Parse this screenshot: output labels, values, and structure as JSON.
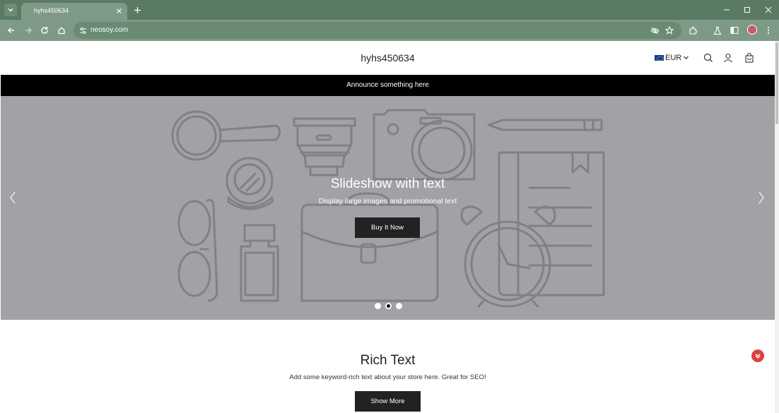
{
  "browser": {
    "tab_title": "hyhs450634",
    "url": "neosoy.com",
    "icons": {
      "tab_menu": "chevron-down-icon",
      "tab_close": "close-icon",
      "new_tab": "plus-icon",
      "minimize": "minimize-icon",
      "maximize": "maximize-icon",
      "close_window": "close-icon",
      "back": "back-arrow-icon",
      "forward": "forward-arrow-icon",
      "reload": "reload-icon",
      "home": "home-icon",
      "site_info": "tune-icon",
      "tracking": "eye-off-icon",
      "bookmark": "star-icon",
      "extensions": "puzzle-icon",
      "labs": "flask-icon",
      "side_panel": "side-panel-icon",
      "menu": "kebab-menu-icon"
    },
    "colors": {
      "frame": "#5a7a63",
      "toolbar": "#7e9a86"
    }
  },
  "header": {
    "store_name": "hyhs450634",
    "currency": "EUR",
    "icons": {
      "search": "search-icon",
      "account": "user-icon",
      "cart": "bag-icon"
    }
  },
  "announcement": {
    "text": "Announce something here"
  },
  "slideshow": {
    "heading": "Slideshow with text",
    "subheading": "Display large images and promotional text",
    "button_label": "Buy It Now",
    "active_slide": 2,
    "slide_count": 3,
    "background": "#a0a2a6"
  },
  "rich_text": {
    "title": "Rich Text",
    "text": "Add some keyword-rich text about your store here. Great for SEO!",
    "button_label": "Show More"
  }
}
